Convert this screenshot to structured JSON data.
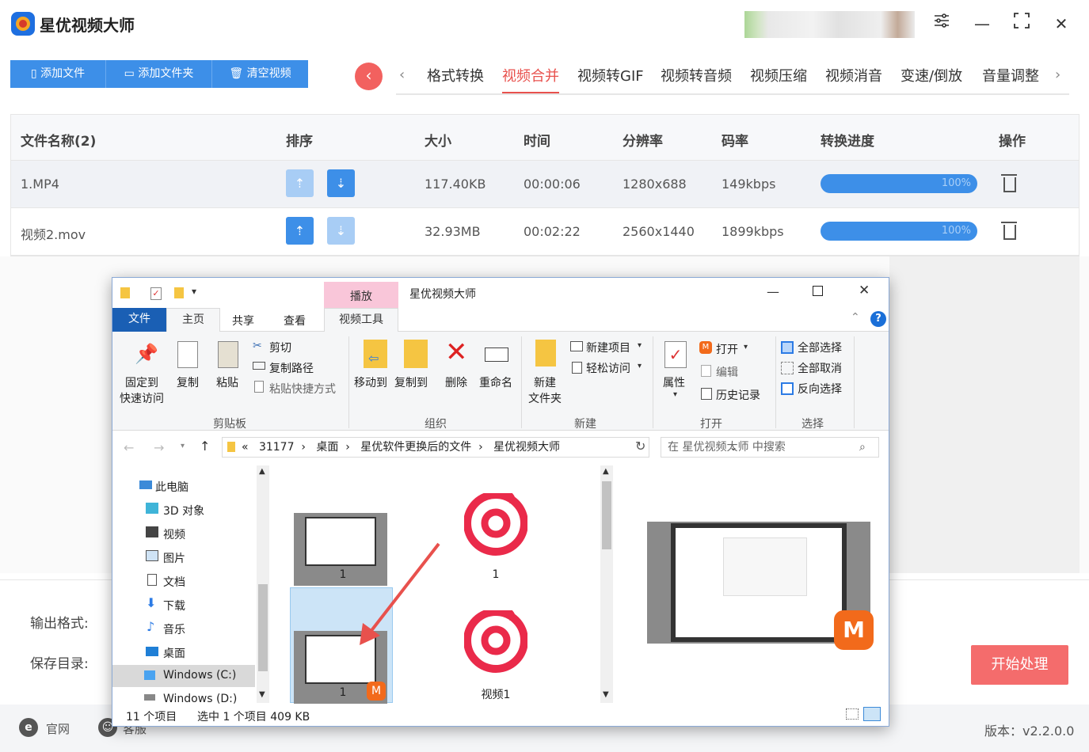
{
  "app": {
    "title": "星优视频大师"
  },
  "toolbar": {
    "add_file": "添加文件",
    "add_folder": "添加文件夹",
    "clear": "清空视频"
  },
  "tabs": [
    {
      "label": "格式转换"
    },
    {
      "label": "视频合并"
    },
    {
      "label": "视频转GIF"
    },
    {
      "label": "视频转音频"
    },
    {
      "label": "视频压缩"
    },
    {
      "label": "视频消音"
    },
    {
      "label": "变速/倒放"
    },
    {
      "label": "音量调整"
    }
  ],
  "table": {
    "headers": {
      "name": "文件名称(2)",
      "sort": "排序",
      "size": "大小",
      "time": "时间",
      "resolution": "分辨率",
      "bitrate": "码率",
      "progress": "转换进度",
      "action": "操作"
    },
    "rows": [
      {
        "name": "1.MP4",
        "size": "117.40KB",
        "time": "00:00:06",
        "resolution": "1280x688",
        "bitrate": "149kbps",
        "progress": "100%"
      },
      {
        "name": "视频2.mov",
        "size": "32.93MB",
        "time": "00:02:22",
        "resolution": "2560x1440",
        "bitrate": "1899kbps",
        "progress": "100%"
      }
    ]
  },
  "bottom": {
    "output_format": "输出格式:",
    "save_dir": "保存目录:",
    "start": "开始处理"
  },
  "footer": {
    "website": "官网",
    "service": "客服",
    "version": "版本：v2.2.0.0"
  },
  "explorer": {
    "title": "星优视频大师",
    "context_tab": "播放",
    "ribbon_tabs": {
      "file": "文件",
      "home": "主页",
      "share": "共享",
      "view": "查看",
      "video_tools": "视频工具"
    },
    "ribbon": {
      "pin": "固定到",
      "pin2": "快速访问",
      "copy": "复制",
      "paste": "粘贴",
      "cut": "剪切",
      "copy_path": "复制路径",
      "paste_shortcut": "粘贴快捷方式",
      "group_clipboard": "剪贴板",
      "move_to": "移动到",
      "copy_to": "复制到",
      "delete": "删除",
      "rename": "重命名",
      "group_organize": "组织",
      "new_folder": "新建",
      "new_folder2": "文件夹",
      "new_item": "新建项目",
      "easy_access": "轻松访问",
      "group_new": "新建",
      "properties": "属性",
      "open": "打开",
      "edit": "编辑",
      "history": "历史记录",
      "group_open": "打开",
      "select_all": "全部选择",
      "select_none": "全部取消",
      "invert": "反向选择",
      "group_select": "选择"
    },
    "address": {
      "p0": "«",
      "p1": "31177",
      "p2": "桌面",
      "p3": "星优软件更换后的文件",
      "p4": "星优视频大师"
    },
    "search_placeholder": "在 星优视频大师 中搜索",
    "nav": [
      "此电脑",
      "3D 对象",
      "视频",
      "图片",
      "文档",
      "下载",
      "音乐",
      "桌面",
      "Windows (C:)",
      "Windows (D:)"
    ],
    "files": [
      {
        "label": "1"
      },
      {
        "label": "1"
      },
      {
        "label": "1"
      },
      {
        "label": "视频1"
      }
    ],
    "status": {
      "count": "11 个项目",
      "selected": "选中 1 个项目  409 KB"
    }
  },
  "colors": {
    "accent": "#3d8fe8",
    "tab_active": "#e8514d",
    "start": "#f46c6c"
  }
}
